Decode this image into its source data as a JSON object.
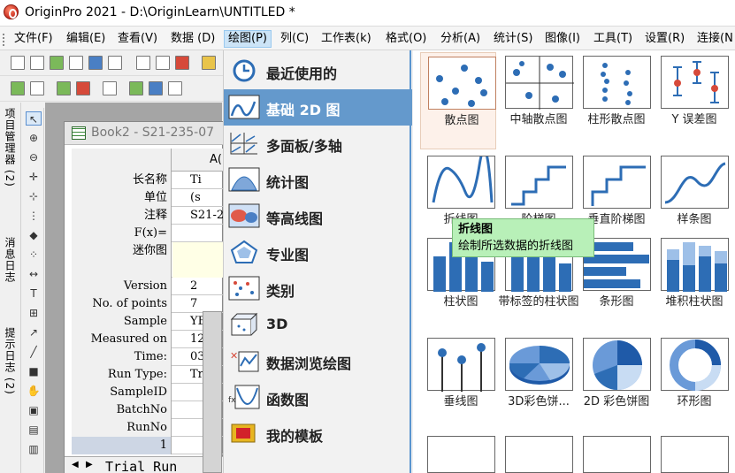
{
  "window": {
    "title": "OriginPro 2021 - D:\\OriginLearn\\UNTITLED *"
  },
  "menu": [
    {
      "label": "文件(F)",
      "active": false
    },
    {
      "label": "编辑(E)",
      "active": false
    },
    {
      "label": "查看(V)",
      "active": false
    },
    {
      "label": "数据 (D)",
      "active": false
    },
    {
      "label": "绘图(P)",
      "active": true
    },
    {
      "label": "列(C)",
      "active": false
    },
    {
      "label": "工作表(k)",
      "active": false
    },
    {
      "label": "格式(O)",
      "active": false
    },
    {
      "label": "分析(A)",
      "active": false
    },
    {
      "label": "统计(S)",
      "active": false
    },
    {
      "label": "图像(I)",
      "active": false
    },
    {
      "label": "工具(T)",
      "active": false
    },
    {
      "label": "设置(R)",
      "active": false
    },
    {
      "label": "连接(N",
      "active": false
    }
  ],
  "left_tabs": [
    "项目管理器 (2)",
    "消息日志",
    "提示日志 (2)"
  ],
  "book": {
    "title": "Book2 - S21-235-07",
    "column_letter": "A(",
    "rows": [
      {
        "label": "长名称",
        "value": "Ti"
      },
      {
        "label": "单位",
        "value": "(s"
      },
      {
        "label": "注释",
        "value": "S21-2"
      },
      {
        "label": "F(x)=",
        "value": ""
      },
      {
        "label": "迷你图",
        "value": ""
      },
      {
        "label": "Version",
        "value": "2"
      },
      {
        "label": "No. of points",
        "value": "7"
      },
      {
        "label": "Sample",
        "value": "YB"
      },
      {
        "label": "Measured on",
        "value": "12"
      },
      {
        "label": "Time:",
        "value": "03"
      },
      {
        "label": "Run Type:",
        "value": "Tr"
      },
      {
        "label": "SampleID",
        "value": ""
      },
      {
        "label": "BatchNo",
        "value": ""
      },
      {
        "label": "RunNo",
        "value": ""
      },
      {
        "label": "1",
        "value": ""
      }
    ],
    "sheet_tab": "Trial Run"
  },
  "plot_menu": [
    {
      "label": "最近使用的",
      "icon": "recent-icon",
      "highlighted": false
    },
    {
      "label": "基础 2D 图",
      "icon": "basic-2d-icon",
      "highlighted": true
    },
    {
      "label": "多面板/多轴",
      "icon": "multi-panel-icon",
      "highlighted": false
    },
    {
      "label": "统计图",
      "icon": "statistics-icon",
      "highlighted": false
    },
    {
      "label": "等高线图",
      "icon": "contour-icon",
      "highlighted": false
    },
    {
      "label": "专业图",
      "icon": "specialized-icon",
      "highlighted": false
    },
    {
      "label": "类别",
      "icon": "category-icon",
      "highlighted": false
    },
    {
      "label": "3D",
      "icon": "3d-icon",
      "highlighted": false
    },
    {
      "label": "数据浏览绘图",
      "icon": "data-browse-icon",
      "highlighted": false
    },
    {
      "label": "函数图",
      "icon": "function-icon",
      "highlighted": false
    },
    {
      "label": "我的模板",
      "icon": "template-icon",
      "highlighted": false
    }
  ],
  "gallery": [
    {
      "label": "散点图",
      "icon": "scatter-icon"
    },
    {
      "label": "中轴散点图",
      "icon": "central-axis-scatter-icon"
    },
    {
      "label": "柱形散点图",
      "icon": "column-scatter-icon"
    },
    {
      "label": "Y 误差图",
      "icon": "y-error-icon"
    },
    {
      "label": "折线图",
      "icon": "line-icon"
    },
    {
      "label": "阶梯图",
      "icon": "step-icon"
    },
    {
      "label": "垂直阶梯图",
      "icon": "vertical-step-icon"
    },
    {
      "label": "样条图",
      "icon": "spline-icon"
    },
    {
      "label": "柱状图",
      "icon": "column-icon"
    },
    {
      "label": "带标签的柱状图",
      "icon": "labeled-column-icon"
    },
    {
      "label": "条形图",
      "icon": "bar-icon"
    },
    {
      "label": "堆积柱状图",
      "icon": "stacked-column-icon"
    },
    {
      "label": "垂线图",
      "icon": "drop-line-icon"
    },
    {
      "label": "3D彩色饼...",
      "icon": "3d-pie-icon"
    },
    {
      "label": "2D 彩色饼图",
      "icon": "2d-pie-icon"
    },
    {
      "label": "环形图",
      "icon": "doughnut-icon"
    }
  ],
  "tooltip": {
    "title": "折线图",
    "text": "绘制所选数据的折线图"
  }
}
